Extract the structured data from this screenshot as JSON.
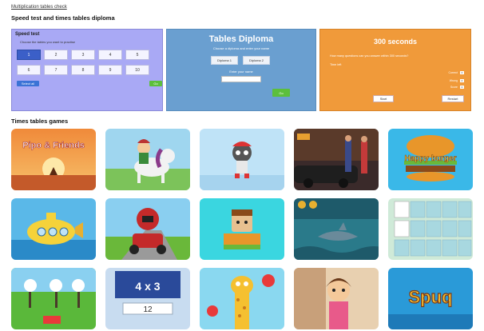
{
  "breadcrumb": "Multiplication tables check",
  "page_title": "Speed test and times tables diploma",
  "speed_test": {
    "title": "Speed test",
    "description": "Choose the tables you want to practise",
    "row1": [
      "1",
      "2",
      "3",
      "4",
      "5"
    ],
    "row2": [
      "6",
      "7",
      "8",
      "9",
      "10"
    ],
    "select_all_label": "Select all",
    "start_label": "Go"
  },
  "diploma": {
    "title": "Tables Diploma",
    "description": "Choose a diploma and enter your name",
    "options": [
      "Diploma 1",
      "Diploma 2"
    ],
    "name_label": "Enter your name",
    "name_value": "",
    "go_label": "Go"
  },
  "seconds_test": {
    "title": "300 seconds",
    "description": "How many questions can you answer within 300 seconds?",
    "timer_label": "Time left",
    "stats": [
      {
        "label": "Correct",
        "value": "0"
      },
      {
        "label": "Wrong",
        "value": "0"
      },
      {
        "label": "Score",
        "value": "0"
      }
    ],
    "start_label": "Start",
    "reset_label": "Restart"
  },
  "games_heading": "Times tables games",
  "games": [
    {
      "name": "Pipo & Friends",
      "text": "Pipo & Friends"
    },
    {
      "name": "Pony rider",
      "text": ""
    },
    {
      "name": "Raccoon runner",
      "text": ""
    },
    {
      "name": "City chase",
      "text": ""
    },
    {
      "name": "Happy burger",
      "text": "Happy burger"
    },
    {
      "name": "Submarine",
      "text": ""
    },
    {
      "name": "Kart racer",
      "text": ""
    },
    {
      "name": "Jumping blocks",
      "text": ""
    },
    {
      "name": "Shark attack",
      "text": ""
    },
    {
      "name": "Memory match",
      "text": ""
    },
    {
      "name": "Music notes",
      "text": ""
    },
    {
      "name": "Quick sum",
      "text": "4 x 3",
      "answer": "12"
    },
    {
      "name": "Giraffe balloons",
      "text": ""
    },
    {
      "name": "Girl adventure",
      "text": ""
    },
    {
      "name": "Spuq",
      "text": "Spuq"
    }
  ],
  "colors": {
    "speed_panel": "#a9a9f5",
    "diploma_panel": "#6a9fd0",
    "seconds_panel": "#f09a3a",
    "accent_blue": "#3b73d6",
    "accent_green": "#5cbf3c"
  }
}
